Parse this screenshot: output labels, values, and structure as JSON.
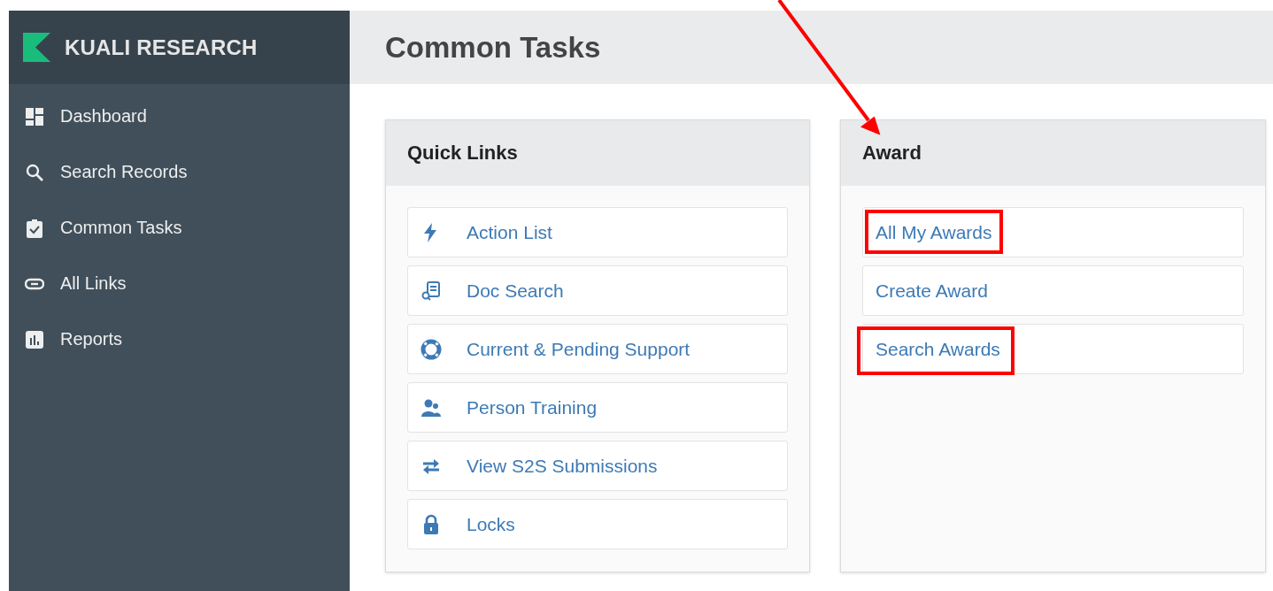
{
  "sidebar": {
    "brand": "KUALI RESEARCH",
    "items": [
      {
        "label": "Dashboard"
      },
      {
        "label": "Search Records"
      },
      {
        "label": "Common Tasks"
      },
      {
        "label": "All Links"
      },
      {
        "label": "Reports"
      }
    ]
  },
  "page_title": "Common Tasks",
  "quick_links": {
    "title": "Quick Links",
    "links": [
      {
        "label": "Action List"
      },
      {
        "label": "Doc Search"
      },
      {
        "label": "Current & Pending Support"
      },
      {
        "label": "Person Training"
      },
      {
        "label": "View S2S Submissions"
      },
      {
        "label": "Locks"
      }
    ]
  },
  "award": {
    "title": "Award",
    "links": [
      {
        "label": "All My Awards",
        "highlighted": true
      },
      {
        "label": "Create Award",
        "highlighted": false
      },
      {
        "label": "Search Awards",
        "highlighted": true
      }
    ]
  }
}
